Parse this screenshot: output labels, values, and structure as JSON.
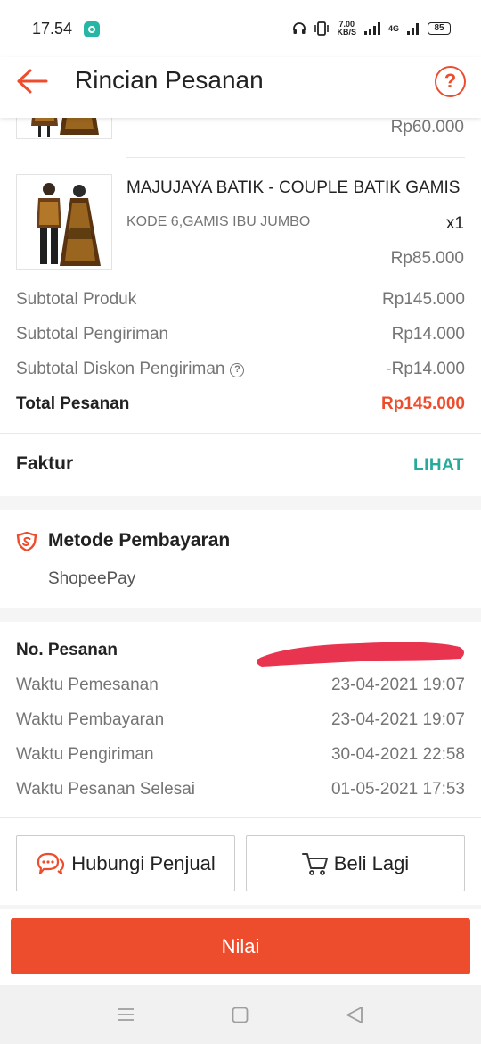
{
  "status_bar": {
    "time": "17.54",
    "net_speed_value": "7.00",
    "net_speed_unit": "KB/S",
    "network_type": "4G",
    "battery": "85"
  },
  "header": {
    "title": "Rincian Pesanan",
    "help_glyph": "?",
    "back_icon": "arrow-left-icon"
  },
  "products": [
    {
      "price": "Rp60.000"
    },
    {
      "name": "MAJUJAYA BATIK - COUPLE BATIK GAMIS",
      "variant": "KODE 6,GAMIS IBU JUMBO",
      "qty": "x1",
      "price": "Rp85.000"
    }
  ],
  "summary": [
    {
      "label": "Subtotal Produk",
      "value": "Rp145.000"
    },
    {
      "label": "Subtotal Pengiriman",
      "value": "Rp14.000"
    },
    {
      "label": "Subtotal Diskon Pengiriman",
      "value": "-Rp14.000"
    },
    {
      "label": "Total Pesanan",
      "value": "Rp145.000"
    }
  ],
  "invoice": {
    "label": "Faktur",
    "action": "LIHAT"
  },
  "payment": {
    "title": "Metode Pembayaran",
    "method": "ShopeePay"
  },
  "order_info": {
    "order_no_label": "No. Pesanan",
    "rows": [
      {
        "label": "Waktu Pemesanan",
        "value": "23-04-2021 19:07"
      },
      {
        "label": "Waktu Pembayaran",
        "value": "23-04-2021 19:07"
      },
      {
        "label": "Waktu Pengiriman",
        "value": "30-04-2021 22:58"
      },
      {
        "label": "Waktu Pesanan Selesai",
        "value": "01-05-2021 17:53"
      }
    ]
  },
  "actions": {
    "contact_seller": "Hubungi Penjual",
    "buy_again": "Beli Lagi",
    "rate": "Nilai"
  },
  "colors": {
    "accent": "#ee4d2d",
    "link": "#26aa99",
    "muted_text": "#757575",
    "redaction": "#e8344e"
  }
}
